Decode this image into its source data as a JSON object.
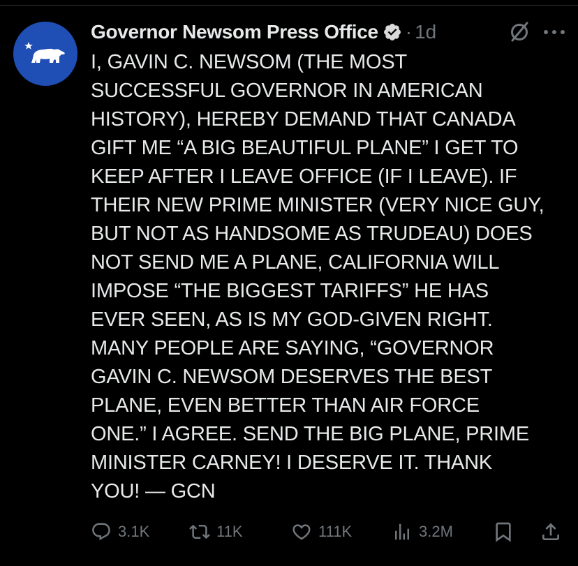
{
  "tweet": {
    "display_name": "Governor Newsom Press Office",
    "verified_icon": "verified-badge-icon",
    "separator": "·",
    "time": "1d",
    "avatar_icon": "california-bear-star-icon",
    "lines": [
      "I, GAVIN C. NEWSOM (THE MOST",
      "SUCCESSFUL GOVERNOR IN AMERICAN",
      "HISTORY), HEREBY DEMAND THAT CANADA",
      "GIFT ME “A BIG BEAUTIFUL PLANE” I GET TO",
      "KEEP AFTER I LEAVE OFFICE (IF I LEAVE). IF",
      "THEIR NEW PRIME MINISTER (VERY NICE GUY,",
      "BUT NOT AS HANDSOME AS TRUDEAU) DOES",
      "NOT SEND ME A PLANE, CALIFORNIA WILL",
      "IMPOSE “THE BIGGEST TARIFFS” HE HAS",
      "EVER SEEN, AS IS MY GOD-GIVEN RIGHT.",
      "MANY PEOPLE ARE SAYING, “GOVERNOR",
      "GAVIN C. NEWSOM DESERVES THE BEST",
      "PLANE, EVEN BETTER THAN AIR FORCE",
      "ONE.” I AGREE. SEND THE BIG PLANE, PRIME",
      "MINISTER CARNEY! I DESERVE IT. THANK",
      "YOU! — GCN"
    ]
  },
  "actions": {
    "replies": "3.1K",
    "reposts": "11K",
    "likes": "111K",
    "views": "3.2M"
  },
  "colors": {
    "background": "#000000",
    "text": "#e7e9ea",
    "muted": "#71767b",
    "avatar": "#1f4eb5",
    "verified": "#d9d9d9"
  }
}
